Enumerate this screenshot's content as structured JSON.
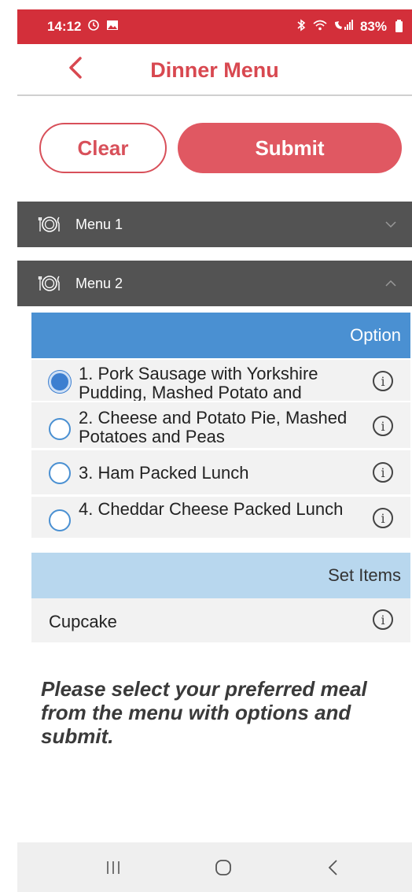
{
  "status_bar": {
    "time": "14:12",
    "battery": "83%",
    "color": "#d32f3a"
  },
  "header": {
    "title": "Dinner Menu",
    "accent": "#d84850"
  },
  "actions": {
    "clear_label": "Clear",
    "submit_label": "Submit"
  },
  "menus": [
    {
      "label": "Menu 1",
      "expanded": false,
      "icon": "plate-cutlery-icon"
    },
    {
      "label": "Menu 2",
      "expanded": true,
      "icon": "plate-cutlery-icon"
    }
  ],
  "options_panel": {
    "header": "Option",
    "header_color": "#4a90d2",
    "options": [
      {
        "label": "1. Pork Sausage with Yorkshire Pudding, Mashed Potato and",
        "selected": true
      },
      {
        "label": "2. Cheese and Potato Pie, Mashed Potatoes and Peas",
        "selected": false
      },
      {
        "label": "3. Ham Packed Lunch",
        "selected": false
      },
      {
        "label": "4. Cheddar Cheese Packed Lunch",
        "selected": false
      }
    ]
  },
  "set_items_panel": {
    "header": "Set Items",
    "header_color": "#b8d7ee",
    "items": [
      {
        "label": "Cupcake"
      }
    ]
  },
  "instructions": "Please select your preferred meal from the menu with options and submit."
}
